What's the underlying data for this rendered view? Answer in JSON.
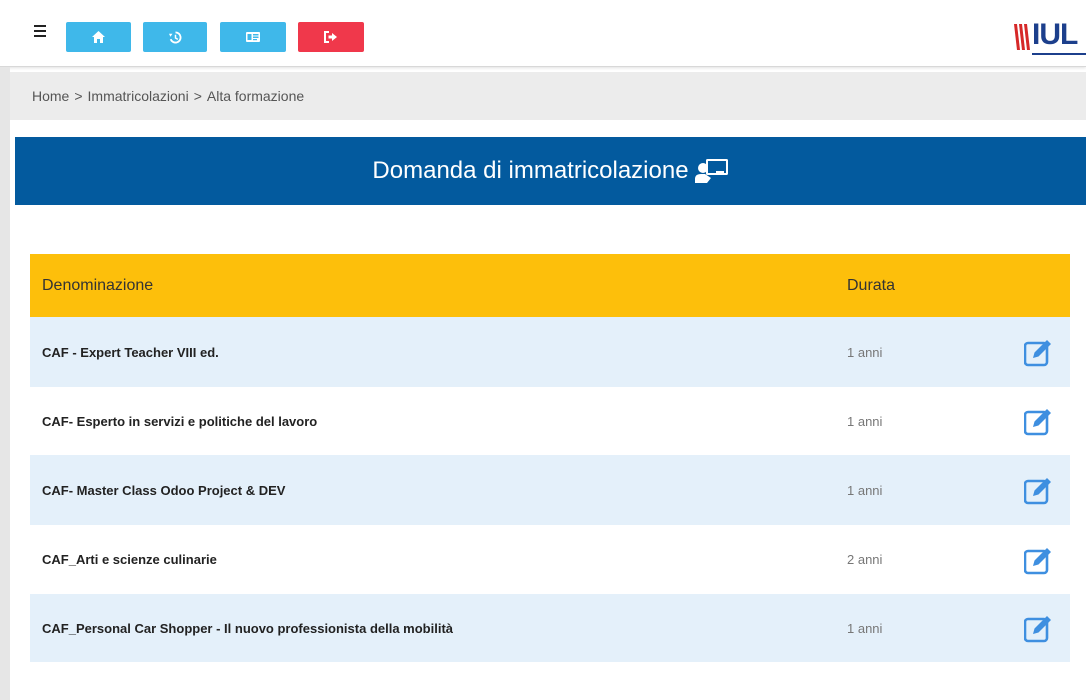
{
  "toolbar": {
    "buttons": [
      {
        "name": "home-icon",
        "color": "#3fb8ea"
      },
      {
        "name": "history-icon",
        "color": "#3fb8ea"
      },
      {
        "name": "id-card-icon",
        "color": "#3fb8ea"
      },
      {
        "name": "sign-out-icon",
        "color": "#f0384b"
      }
    ],
    "logo_text": "IUL"
  },
  "breadcrumb": {
    "items": [
      "Home",
      "Immatricolazioni",
      "Alta formazione"
    ],
    "separator": ">"
  },
  "banner": {
    "title": "Domanda di immatricolazione",
    "color": "#035a9e",
    "icon": "chalkboard-teacher-icon"
  },
  "table": {
    "header_color": "#fdbf0b",
    "alt_row_color": "#e4f0fa",
    "headers": {
      "name": "Denominazione",
      "duration": "Durata"
    },
    "rows": [
      {
        "name": "CAF - Expert Teacher VIII ed.",
        "duration": "1 anni"
      },
      {
        "name": "CAF- Esperto in servizi e politiche del lavoro",
        "duration": "1 anni"
      },
      {
        "name": "CAF- Master Class Odoo Project & DEV",
        "duration": "1 anni"
      },
      {
        "name": "CAF_Arti e scienze culinarie",
        "duration": "2 anni"
      },
      {
        "name": "CAF_Personal Car Shopper - Il nuovo professionista della mobilità",
        "duration": "1 anni"
      }
    ],
    "edit_icon": "edit-icon"
  }
}
